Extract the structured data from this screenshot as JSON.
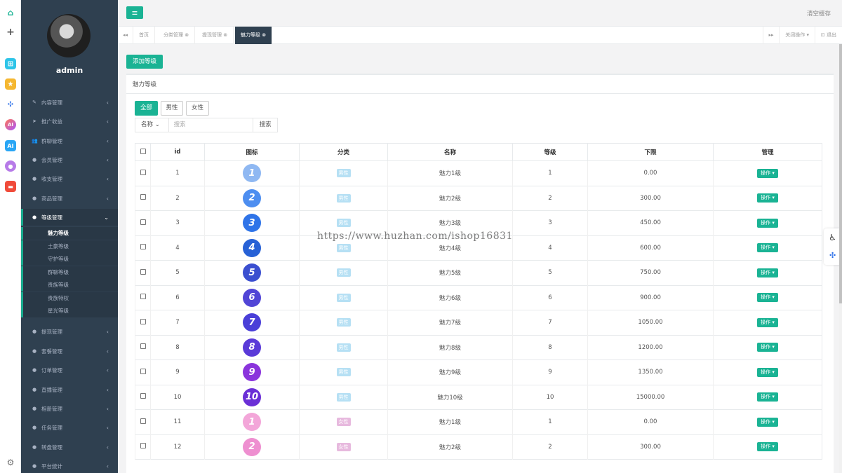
{
  "user": {
    "name": "admin"
  },
  "rail_icons": [
    "home-icon",
    "plus-icon",
    "app-blue-icon",
    "star-icon",
    "share-icon",
    "ai-ring-icon",
    "ai-badge-icon",
    "chat-bubble-icon",
    "gamepad-icon",
    "settings-icon"
  ],
  "sidebar": {
    "items": [
      {
        "label": "内容管理",
        "icon": "✎"
      },
      {
        "label": "推广收益",
        "icon": "➤"
      },
      {
        "label": "群聊管理",
        "icon": "👥"
      },
      {
        "label": "会员管理",
        "icon": "●"
      },
      {
        "label": "收支管理",
        "icon": "●"
      },
      {
        "label": "商品管理",
        "icon": "●"
      },
      {
        "label": "等级管理",
        "icon": "●"
      },
      {
        "label": "提现管理",
        "icon": "●"
      },
      {
        "label": "套餐管理",
        "icon": "●"
      },
      {
        "label": "订单管理",
        "icon": "●"
      },
      {
        "label": "直播管理",
        "icon": "●"
      },
      {
        "label": "相册管理",
        "icon": "●"
      },
      {
        "label": "任务管理",
        "icon": "●"
      },
      {
        "label": "转盘管理",
        "icon": "●"
      },
      {
        "label": "平台统计",
        "icon": "●"
      }
    ],
    "subitems": [
      "魅力等级",
      "土豪等级",
      "守护等级",
      "群聊等级",
      "贵族等级",
      "贵族特权",
      "星光等级"
    ]
  },
  "topbar": {
    "menu_icon": "≡",
    "clear_cache": "清空缓存"
  },
  "tabs": {
    "prev": "◂◂",
    "items": [
      "首页",
      "分类管理 ⊗",
      "提现管理 ⊗",
      "魅力等级 ⊗"
    ],
    "next": "▸▸",
    "close_ops": "关闭操作 ▾",
    "logout": "⊡ 退出"
  },
  "toolbar": {
    "add_label": "添加等级"
  },
  "panel": {
    "title": "魅力等级"
  },
  "filters": [
    "全部",
    "男性",
    "女性"
  ],
  "search": {
    "field": "名称",
    "caret": "⌄",
    "placeholder": "搜索",
    "button": "搜索"
  },
  "table": {
    "headers": [
      "id",
      "图标",
      "分类",
      "名称",
      "等级",
      "下限",
      "管理"
    ],
    "op_label": "操作 ▾",
    "rows": [
      {
        "id": "1",
        "icon": "1",
        "cat": "男性",
        "name": "魅力1级",
        "level": "1",
        "min": "0.00",
        "color": "#8fb8f2"
      },
      {
        "id": "2",
        "icon": "2",
        "cat": "男性",
        "name": "魅力2级",
        "level": "2",
        "min": "300.00",
        "color": "#4d8ef0"
      },
      {
        "id": "3",
        "icon": "3",
        "cat": "男性",
        "name": "魅力3级",
        "level": "3",
        "min": "450.00",
        "color": "#2f74e8"
      },
      {
        "id": "4",
        "icon": "4",
        "cat": "男性",
        "name": "魅力4级",
        "level": "4",
        "min": "600.00",
        "color": "#2761d6"
      },
      {
        "id": "5",
        "icon": "5",
        "cat": "男性",
        "name": "魅力5级",
        "level": "5",
        "min": "750.00",
        "color": "#3b4fd0"
      },
      {
        "id": "6",
        "icon": "6",
        "cat": "男性",
        "name": "魅力6级",
        "level": "6",
        "min": "900.00",
        "color": "#5145d6"
      },
      {
        "id": "7",
        "icon": "7",
        "cat": "男性",
        "name": "魅力7级",
        "level": "7",
        "min": "1050.00",
        "color": "#4a3fd8"
      },
      {
        "id": "8",
        "icon": "8",
        "cat": "男性",
        "name": "魅力8级",
        "level": "8",
        "min": "1200.00",
        "color": "#5a3ad8"
      },
      {
        "id": "9",
        "icon": "9",
        "cat": "男性",
        "name": "魅力9级",
        "level": "9",
        "min": "1350.00",
        "color": "#8a34dc"
      },
      {
        "id": "10",
        "icon": "10",
        "cat": "男性",
        "name": "魅力10级",
        "level": "10",
        "min": "15000.00",
        "color": "#6a2fd6"
      },
      {
        "id": "11",
        "icon": "1",
        "cat": "女性",
        "name": "魅力1级",
        "level": "1",
        "min": "0.00",
        "color": "#f3a6d9"
      },
      {
        "id": "12",
        "icon": "2",
        "cat": "女性",
        "name": "魅力2级",
        "level": "2",
        "min": "300.00",
        "color": "#ee8fd0"
      }
    ]
  },
  "colors": {
    "accent": "#1ab394",
    "sidebar": "#2f4050",
    "male_tag": "#b6e0f4",
    "female_tag": "#e7b9de"
  },
  "watermark": "https://www.huzhan.com/ishop16831"
}
